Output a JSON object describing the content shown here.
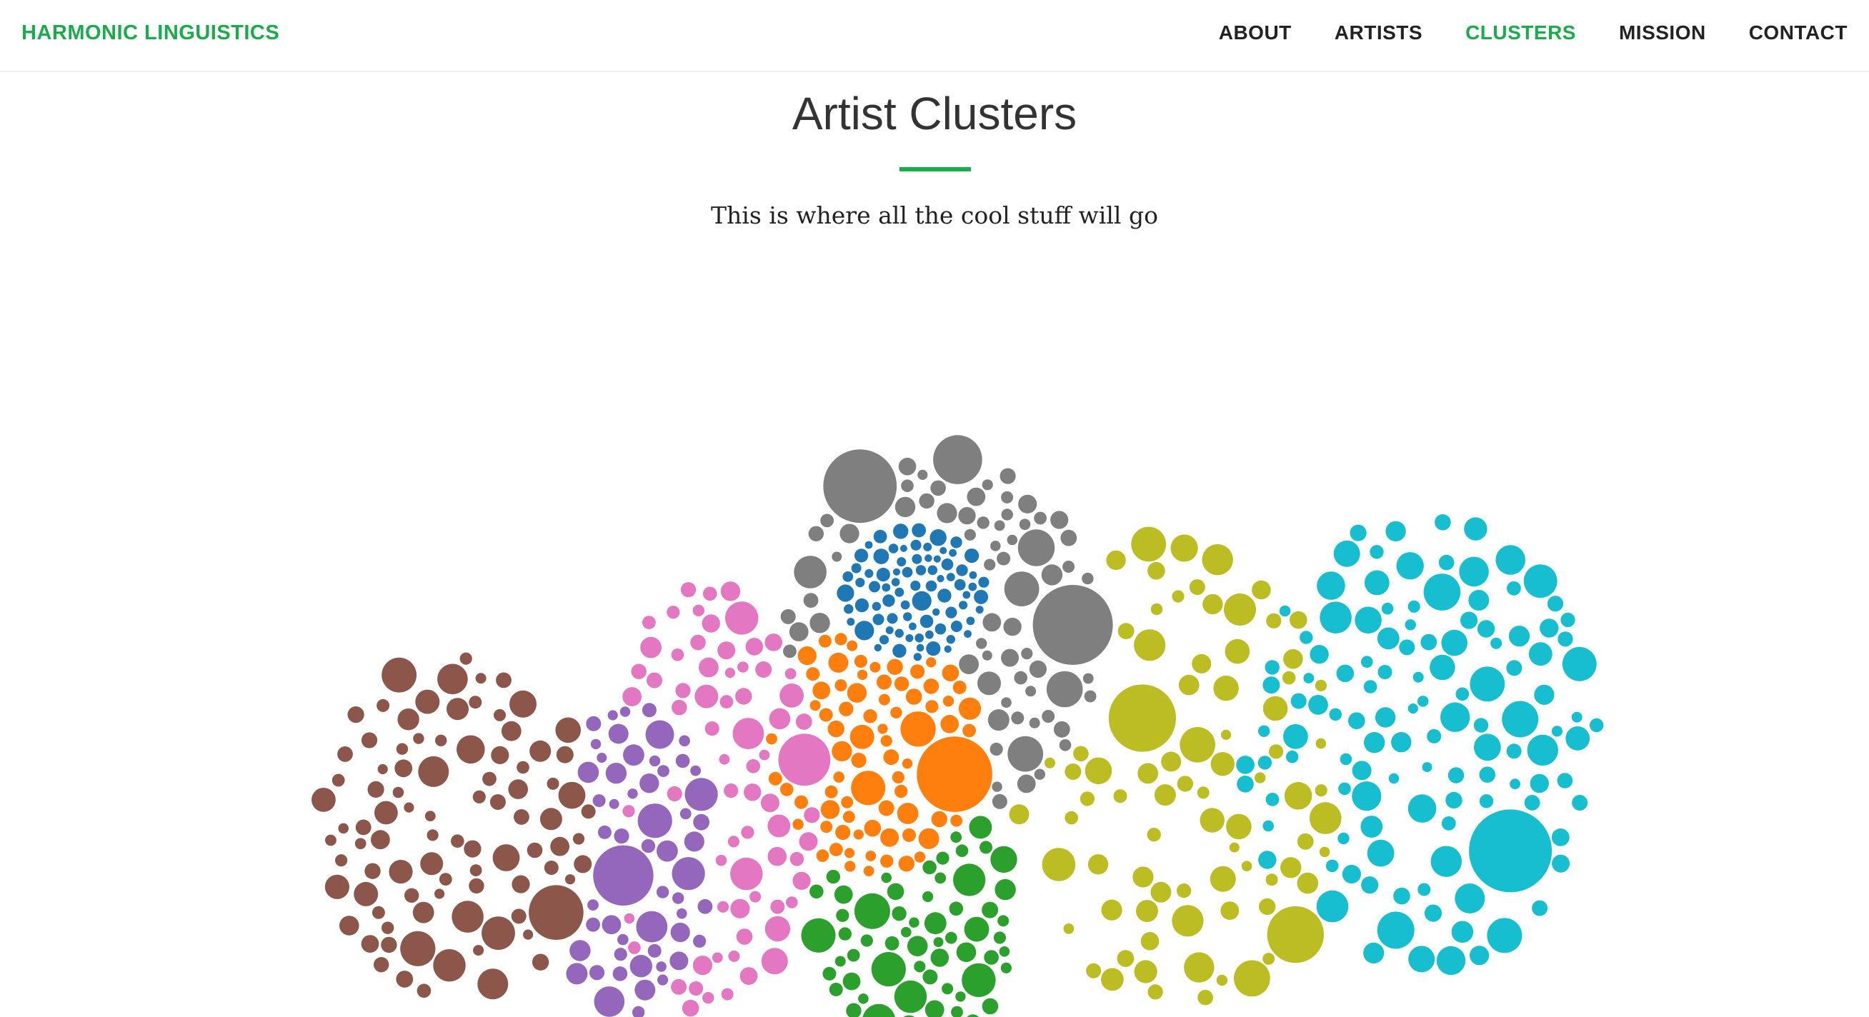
{
  "brand": "HARMONIC LINGUISTICS",
  "nav": [
    {
      "label": "ABOUT",
      "active": false
    },
    {
      "label": "ARTISTS",
      "active": false
    },
    {
      "label": "CLUSTERS",
      "active": true
    },
    {
      "label": "MISSION",
      "active": false
    },
    {
      "label": "CONTACT",
      "active": false
    }
  ],
  "page": {
    "title": "Artist Clusters",
    "subtitle": "This is where all the cool stuff will go"
  },
  "colors": {
    "accent": "#1aab4b",
    "clusters": [
      "#8c564b",
      "#9467bd",
      "#e377c2",
      "#ff7f0e",
      "#2ca02c",
      "#7f7f7f",
      "#1f77b4",
      "#bcbd22",
      "#17becf"
    ]
  },
  "chart_data": {
    "type": "packed-bubble",
    "clusters": [
      {
        "color": "#8c564b",
        "bubbles": 90
      },
      {
        "color": "#9467bd",
        "bubbles": 55
      },
      {
        "color": "#e377c2",
        "bubbles": 70
      },
      {
        "color": "#ff7f0e",
        "bubbles": 75
      },
      {
        "color": "#2ca02c",
        "bubbles": 65
      },
      {
        "color": "#7f7f7f",
        "bubbles": 70
      },
      {
        "color": "#1f77b4",
        "bubbles": 80
      },
      {
        "color": "#bcbd22",
        "bubbles": 80
      },
      {
        "color": "#17becf",
        "bubbles": 120
      }
    ]
  }
}
